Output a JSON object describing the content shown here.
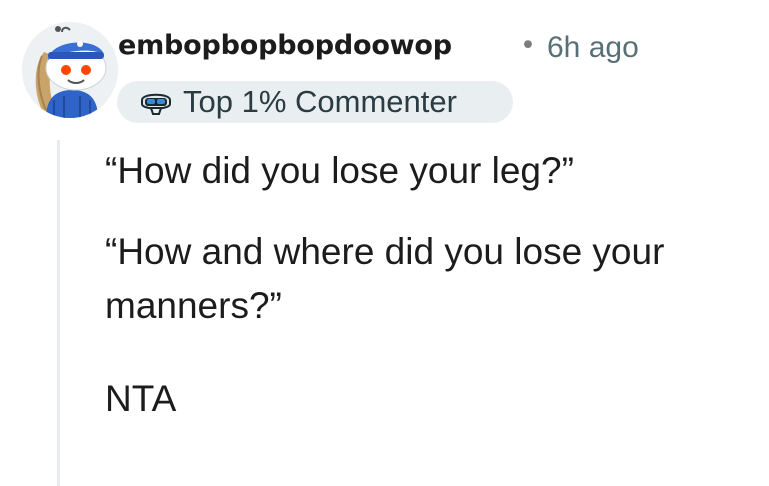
{
  "comment": {
    "author": "embopbopbopdoowop",
    "separator": "•",
    "time_ago": "6h ago",
    "flair": {
      "label": "Top 1% Commenter",
      "icon": "top-commenter-icon"
    },
    "avatar": "snoo-avatar-icon",
    "paragraphs": [
      "“How did you lose your leg?”",
      "“How and where did you lose your manners?”",
      "NTA"
    ]
  },
  "colors": {
    "text": "#1c1c1c",
    "meta": "#576f76",
    "flair_bg": "#e9eef0",
    "thread_line": "#e5ebee",
    "avatar_accent": "#3a6fd6"
  }
}
